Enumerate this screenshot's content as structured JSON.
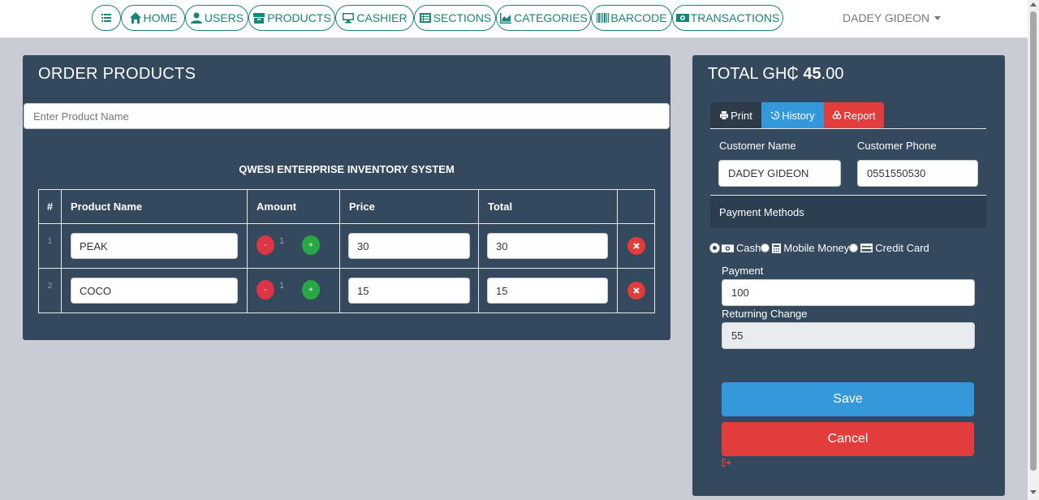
{
  "nav": {
    "items": [
      {
        "label": "",
        "icon": "list-icon"
      },
      {
        "label": "HOME",
        "icon": "home-icon"
      },
      {
        "label": "USERS",
        "icon": "user-icon"
      },
      {
        "label": "PRODUCTS",
        "icon": "box-icon"
      },
      {
        "label": "CASHIER",
        "icon": "desktop-icon"
      },
      {
        "label": "SECTIONS",
        "icon": "sections-icon"
      },
      {
        "label": "CATEGORIES",
        "icon": "chart-icon"
      },
      {
        "label": "BARCODE",
        "icon": "barcode-icon"
      },
      {
        "label": "TRANSACTIONS",
        "icon": "money-icon"
      }
    ],
    "user": "DADEY GIDEON"
  },
  "order": {
    "title": "ORDER PRODUCTS",
    "search_placeholder": "Enter Product Name",
    "system_title": "QWESI ENTERPRISE INVENTORY SYSTEM",
    "headers": [
      "#",
      "Product Name",
      "Amount",
      "Price",
      "Total"
    ],
    "rows": [
      {
        "index": "1",
        "name": "PEAK",
        "amount": "1",
        "price": "30",
        "total": "30"
      },
      {
        "index": "2",
        "name": "COCO",
        "amount": "1",
        "price": "15",
        "total": "15"
      }
    ],
    "minus_label": "-",
    "plus_label": "+"
  },
  "summary": {
    "total_prefix": "TOTAL GH₵ ",
    "total_int": "45",
    "total_dec": ".00",
    "tabs": {
      "print": "Print",
      "history": "History",
      "report": "Report"
    },
    "customer_name_label": "Customer Name",
    "customer_name": "DADEY GIDEON",
    "customer_phone_label": "Customer Phone",
    "customer_phone": "0551550530",
    "payment_methods_label": "Payment Methods",
    "methods": [
      "Cash",
      "Mobile Money",
      "Credit Card"
    ],
    "payment_label": "Payment",
    "payment_value": "100",
    "change_label": "Returning Change",
    "change_value": "55",
    "save_label": "Save",
    "cancel_label": "Cancel"
  },
  "colors": {
    "accent": "#17857a",
    "panel": "#34495e",
    "primary": "#3498db",
    "danger": "#e23c3c",
    "success": "#28a745"
  }
}
